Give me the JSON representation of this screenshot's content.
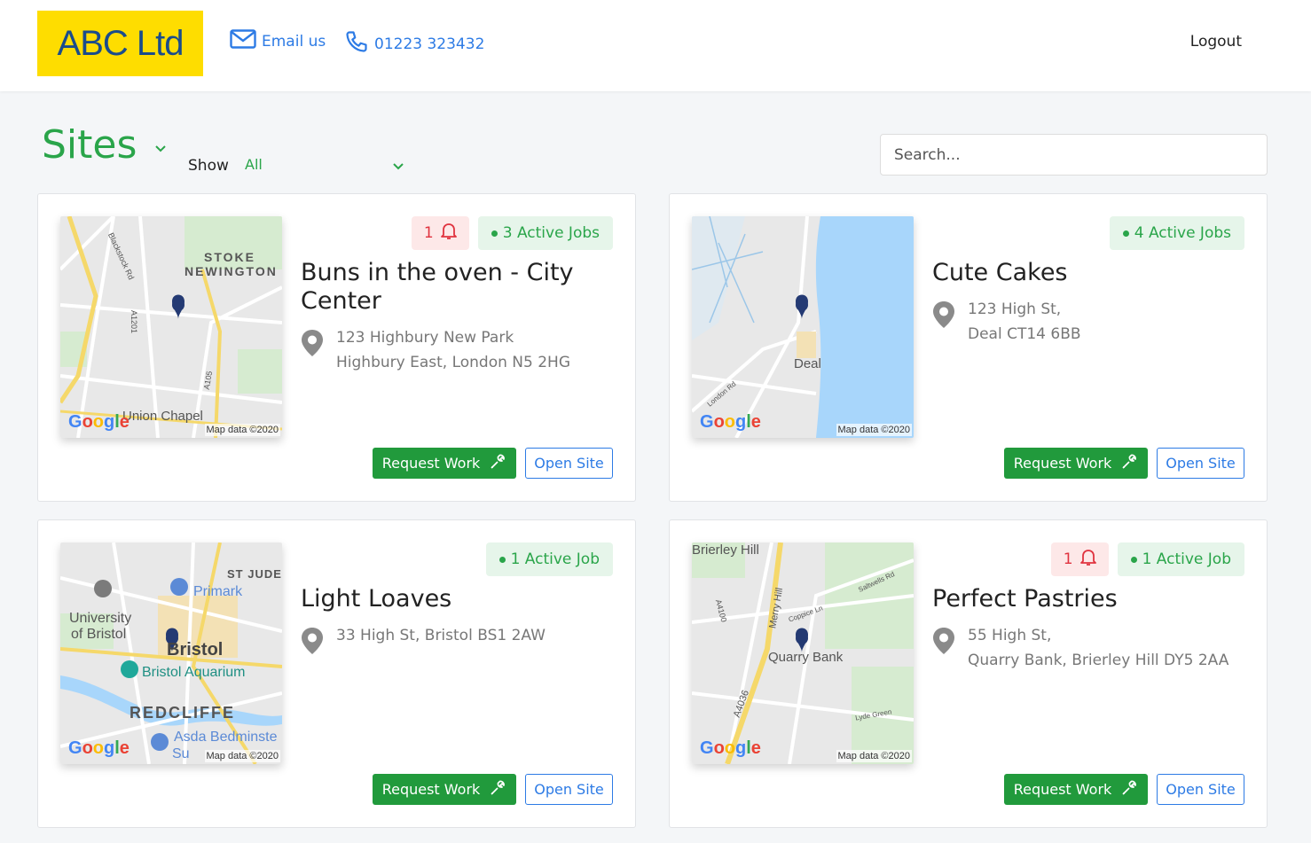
{
  "header": {
    "logo_text": "ABC Ltd",
    "email_label": "Email us",
    "phone_label": "01223 323432",
    "logout_label": "Logout",
    "colors": {
      "logo_bg": "#fedd00",
      "logo_text": "#1a4c8b",
      "link": "#2d7be5"
    }
  },
  "page": {
    "title": "Sites",
    "show_label": "Show",
    "show_value": "All",
    "search_placeholder": "Search..."
  },
  "colors": {
    "accent_green": "#2aa54a",
    "button_green": "#219a3c",
    "alert_red": "#e0333f"
  },
  "sites": [
    {
      "name": "Buns in the oven - City Center",
      "address_line1": "123 Highbury New Park",
      "address_line2": "Highbury East, London N5 2HG",
      "alert_count": "1",
      "active_jobs": "3 Active Jobs",
      "map_labels": [
        "STOKE",
        "NEWINGTON",
        "Union Chapel",
        "A1201",
        "A105",
        "Blackstock Rd"
      ],
      "map_credit": "Map data ©2020",
      "request_label": "Request Work",
      "open_label": "Open Site"
    },
    {
      "name": "Cute Cakes",
      "address_line1": "123 High St,",
      "address_line2": "Deal CT14 6BB",
      "active_jobs": "4 Active Jobs",
      "map_labels": [
        "Deal",
        "London Rd"
      ],
      "map_credit": "Map data ©2020",
      "request_label": "Request Work",
      "open_label": "Open Site"
    },
    {
      "name": "Light Loaves",
      "address_line1": "33 High St, Bristol BS1 2AW",
      "active_jobs": "1 Active Job",
      "map_labels": [
        "ST JUDE",
        "Primark",
        "University",
        "of Bristol",
        "Bristol",
        "Bristol Aquarium",
        "REDCLIFFE",
        "Asda Bedminste",
        "Su"
      ],
      "map_credit": "Map data ©2020",
      "request_label": "Request Work",
      "open_label": "Open Site"
    },
    {
      "name": "Perfect Pastries",
      "address_line1": "55 High St,",
      "address_line2": "Quarry Bank, Brierley Hill DY5 2AA",
      "alert_count": "1",
      "active_jobs": "1 Active Job",
      "map_labels": [
        "Brierley Hill",
        "Merry Hill",
        "A4100",
        "Saltwells Rd",
        "Coppice Ln",
        "Quarry Bank",
        "A4036",
        "Lyde Green"
      ],
      "map_credit": "Map data ©2020",
      "request_label": "Request Work",
      "open_label": "Open Site"
    }
  ],
  "google_logo_text": "Google"
}
